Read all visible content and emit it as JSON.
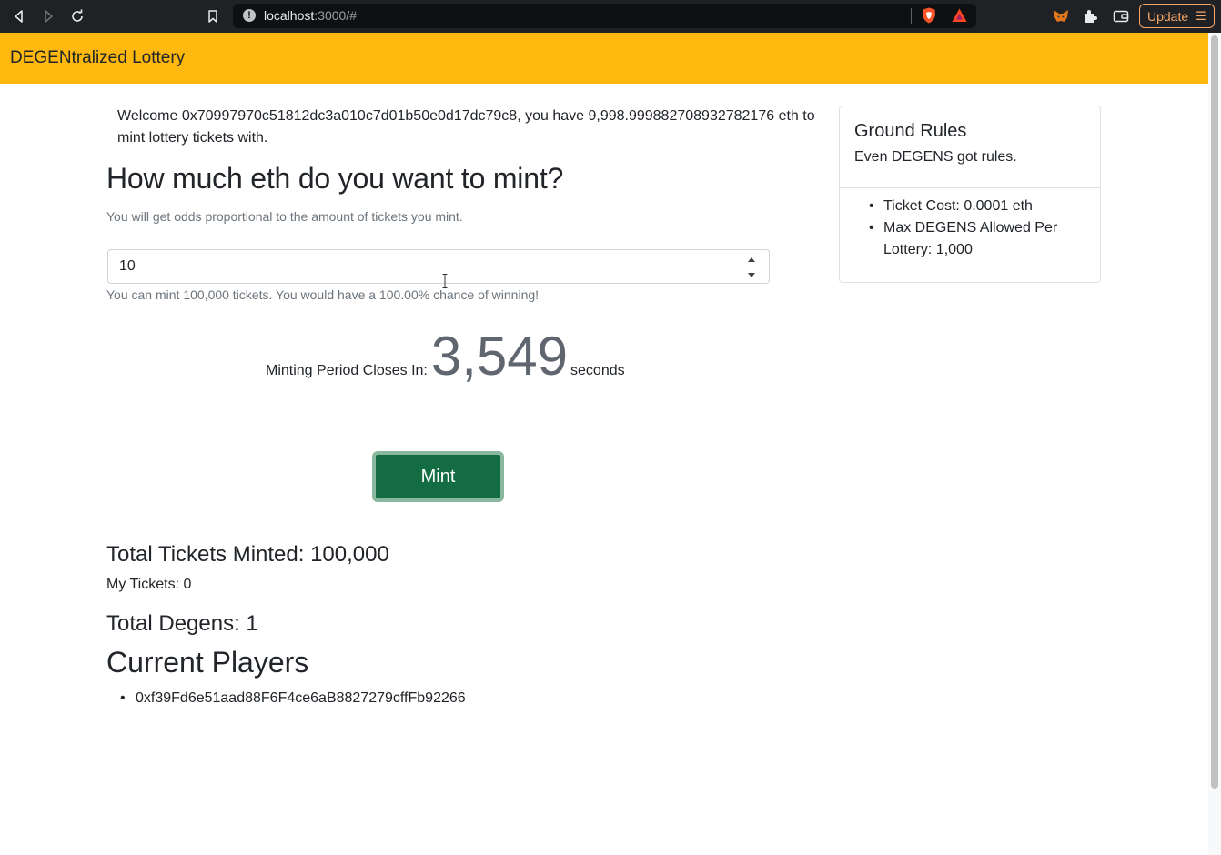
{
  "browser": {
    "url_host": "localhost",
    "url_rest": ":3000/#",
    "update_label": "Update",
    "icons": [
      "back-icon",
      "forward-icon",
      "reload-icon",
      "bookmark-icon",
      "site-info-icon",
      "brave-shields-icon",
      "brave-rewards-icon",
      "metamask-icon",
      "extensions-icon",
      "wallet-icon",
      "menu-icon"
    ]
  },
  "navbar": {
    "brand": "DEGENtralized Lottery",
    "color": "#ffb90e"
  },
  "welcome": {
    "prefix": "Welcome ",
    "address": "0x70997970c51812dc3a010c7d01b50e0d17dc79c8",
    "middle": ", you have ",
    "balance": "9,998.999882708932782176",
    "suffix": " eth to mint lottery tickets with."
  },
  "mint_form": {
    "heading": "How much eth do you want to mint?",
    "odds_text": "You will get odds proportional to the amount of tickets you mint.",
    "input_value": "10",
    "mint_info": "You can mint 100,000 tickets. You would have a 100.00% chance of winning!"
  },
  "countdown": {
    "label": "Minting Period Closes In:",
    "value": "3,549",
    "unit": "seconds"
  },
  "mint_button": {
    "label": "Mint",
    "color": "#146c43"
  },
  "stats": {
    "total_minted": "Total Tickets Minted: 100,000",
    "my_tickets": "My Tickets: 0",
    "total_degens": "Total Degens: 1"
  },
  "players": {
    "heading": "Current Players",
    "list": [
      "0xf39Fd6e51aad88F6F4ce6aB8827279cffFb92266"
    ]
  },
  "rules_card": {
    "title": "Ground Rules",
    "subtitle": "Even DEGENS got rules.",
    "items": [
      "Ticket Cost: 0.0001 eth",
      "Max DEGENS Allowed Per Lottery: 1,000"
    ]
  }
}
